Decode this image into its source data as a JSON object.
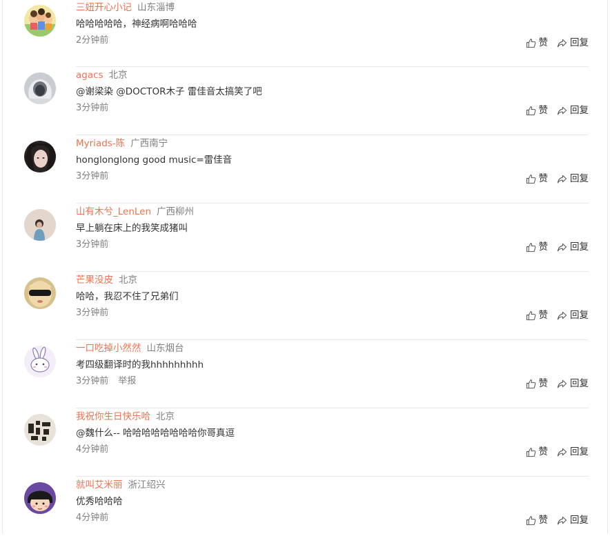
{
  "like_label": "赞",
  "reply_label": "回复",
  "colors": {
    "username": "#eb7350",
    "secondary": "#808080",
    "text": "#333333"
  },
  "comments": [
    {
      "username": "三妞开心小记",
      "location": "山东淄博",
      "text": "哈哈哈哈哈，神经病啊哈哈哈",
      "time": "2分钟前",
      "avatar": "cartoon-avatar"
    },
    {
      "username": "agacs",
      "location": "北京",
      "text": "@谢梁染 @DOCTOR木子 雷佳音太搞笑了吧",
      "time": "3分钟前",
      "avatar": "hooded-avatar"
    },
    {
      "username": "Myriads-陈",
      "location": "广西南宁",
      "text": "honglonglong  good music=雷佳音",
      "time": "3分钟前",
      "avatar": "portrait-avatar"
    },
    {
      "username": "山有木兮_LenLen",
      "location": "广西柳州",
      "text": "早上躺在床上的我笑成猪叫",
      "time": "3分钟前",
      "avatar": "figure-avatar"
    },
    {
      "username": "芒果没皮",
      "location": "北京",
      "text": "哈哈，我忍不住了兄弟们",
      "time": "3分钟前",
      "avatar": "sunglasses-avatar"
    },
    {
      "username": "一口吃掉小然然",
      "location": "山东烟台",
      "text": "考四级翻译时的我hhhhhhhhh",
      "time": "3分钟前",
      "report": "举报",
      "avatar": "bunny-avatar"
    },
    {
      "username": "我祝你生日快乐哈",
      "location": "北京",
      "text": "@魏什么-- 哈哈哈哈哈哈哈哈你哥真逗",
      "time": "4分钟前",
      "avatar": "pattern-avatar"
    },
    {
      "username": "就叫艾米丽",
      "location": "浙江绍兴",
      "text": "优秀哈哈哈",
      "time": "4分钟前",
      "avatar": "maruko-avatar"
    }
  ]
}
